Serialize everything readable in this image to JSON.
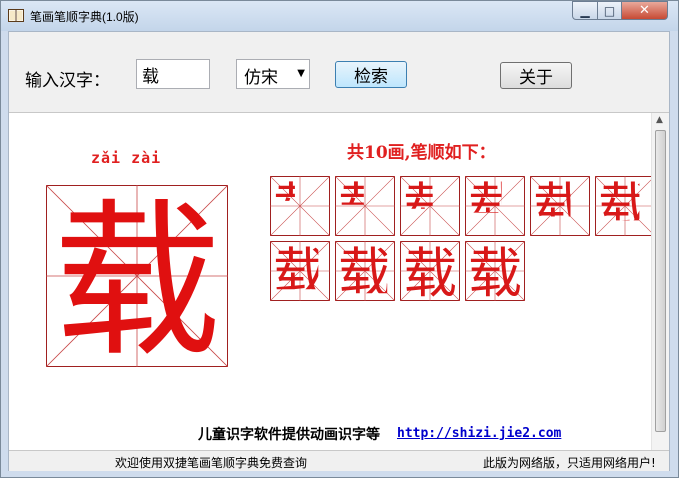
{
  "window": {
    "title": "笔画笔顺字典(1.0版)"
  },
  "toolbar": {
    "input_label": "输入汉字：",
    "char_value": "载",
    "font_value": "仿宋",
    "search_label": "检索",
    "about_label": "关于"
  },
  "result": {
    "pinyin": "zǎi zài",
    "stroke_heading": "共10画,笔顺如下：",
    "big_char": "载",
    "stroke_count": 10,
    "stroke_cells": [
      "1",
      "2",
      "3",
      "4",
      "5",
      "6",
      "7",
      "8",
      "9",
      "10"
    ]
  },
  "promo": {
    "text": "儿童识字软件提供动画识字等",
    "link": "http://shizi.jie2.com"
  },
  "status": {
    "left": "欢迎使用双捷笔画笔顺字典免费查询",
    "right": "此版为网络版，只适用网络用户!"
  },
  "colors": {
    "accent": "#e02020",
    "grid": "#c84848",
    "link": "#0000cc"
  },
  "icons": [
    "book-icon",
    "minimize-icon",
    "maximize-icon",
    "close-icon",
    "dropdown-arrow-icon",
    "scroll-up-icon"
  ]
}
